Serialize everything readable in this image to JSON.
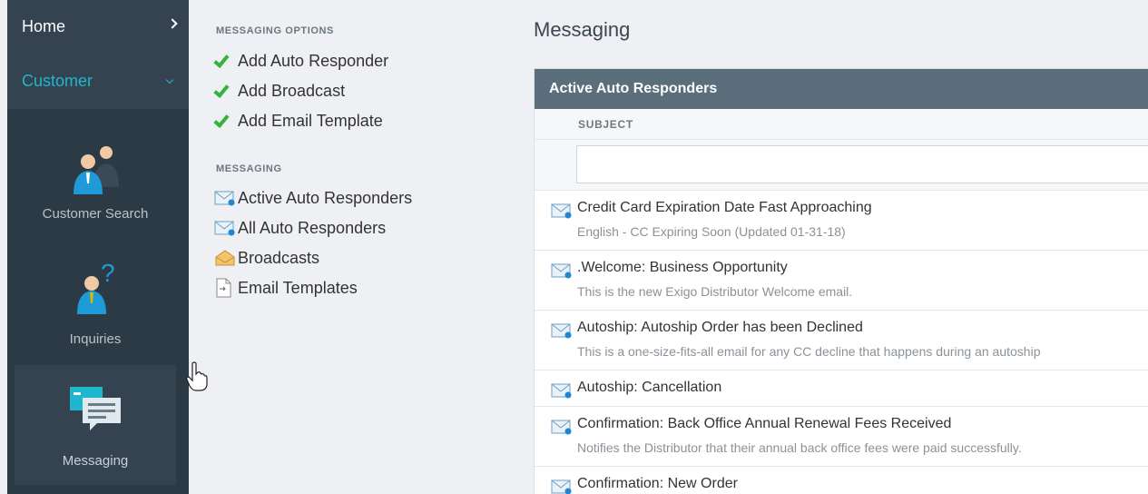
{
  "sidebar": {
    "home_label": "Home",
    "customer_label": "Customer",
    "tiles": [
      {
        "label": "Customer Search",
        "icon": "customer-search-icon"
      },
      {
        "label": "Inquiries",
        "icon": "inquiries-icon"
      },
      {
        "label": "Messaging",
        "icon": "messaging-icon",
        "active": true
      }
    ]
  },
  "options": {
    "messaging_options_heading": "MESSAGING OPTIONS",
    "option_items": [
      {
        "label": "Add Auto Responder",
        "icon": "checkmark-icon"
      },
      {
        "label": "Add Broadcast",
        "icon": "checkmark-icon"
      },
      {
        "label": "Add Email Template",
        "icon": "checkmark-icon"
      }
    ],
    "messaging_heading": "MESSAGING",
    "messaging_items": [
      {
        "label": "Active Auto Responders",
        "icon": "envelope-icon"
      },
      {
        "label": "All Auto Responders",
        "icon": "envelope-icon"
      },
      {
        "label": "Broadcasts",
        "icon": "open-envelope-icon"
      },
      {
        "label": "Email Templates",
        "icon": "document-icon"
      }
    ]
  },
  "main": {
    "title": "Messaging",
    "panel_title": "Active Auto Responders",
    "column_subject": "SUBJECT",
    "filter_value": "",
    "rows": [
      {
        "subject": "Credit Card Expiration Date Fast Approaching",
        "description": "English - CC Expiring Soon (Updated 01-31-18)"
      },
      {
        "subject": ".Welcome: Business Opportunity",
        "description": "This is the new Exigo Distributor Welcome email."
      },
      {
        "subject": "Autoship: Autoship Order has been Declined",
        "description": "This is a one-size-fits-all email for any CC decline that happens during an autoship"
      },
      {
        "subject": "Autoship: Cancellation",
        "description": ""
      },
      {
        "subject": "Confirmation: Back Office Annual Renewal Fees Received",
        "description": "Notifies the Distributor that their annual back office fees were paid successfully."
      },
      {
        "subject": "Confirmation: New Order",
        "description": ""
      }
    ]
  },
  "colors": {
    "sidebar_bg": "#2c3a45",
    "accent_cyan": "#1fb6cf",
    "check_green": "#35b33a",
    "panel_header": "#5a6e7b"
  }
}
